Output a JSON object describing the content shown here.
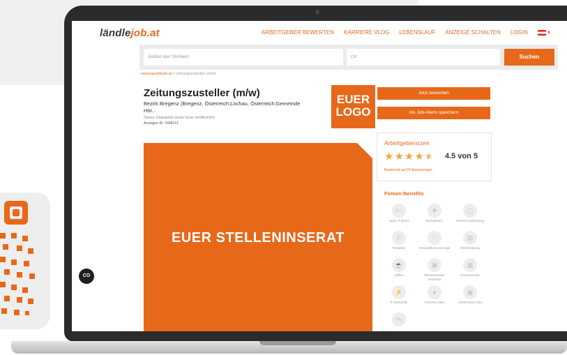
{
  "site": {
    "logo_part1": "ländle",
    "logo_part2": "job.at"
  },
  "nav": {
    "links": [
      "ARBEITGEBER BEWERTEN",
      "KARRIERE VLOG",
      "LEBENSLAUF",
      "ANZEIGE SCHALTEN",
      "LOGIN"
    ],
    "language_marker": "▾"
  },
  "search": {
    "keyword_placeholder": "Jobtitel oder Stichwort",
    "location_placeholder": "Ort",
    "button_label": "Suchen"
  },
  "breadcrumb": {
    "home": "www.laendlejob.at",
    "separator": ">",
    "current": "Zeitungszusteller (m/w)"
  },
  "job": {
    "title": "Zeitungszusteller (m/w)",
    "location": "Bezirk Bregenz (Bregenz, Österreich;Lochau, Österreich;Gemeinde Hör...",
    "published": "Dieses Jobangebot wurde heute veröffentlicht",
    "ad_id": "Anzeigen-ID: 2498212"
  },
  "company_logo_text": {
    "line1": "EUER",
    "line2": "LOGO"
  },
  "actions": {
    "apply": "Jetzt bewerben",
    "job_alarm": "Als Job-Alarm speichern"
  },
  "ad_banner": {
    "text": "EUER STELLENINSERAT"
  },
  "employer_score": {
    "title": "Arbeitgeberscore",
    "rating": 4.5,
    "rating_text": "4.5 von 5",
    "basis": "Basierend auf 24 Bewertungen"
  },
  "benefits": {
    "title": "Firmen Benefits",
    "items": [
      {
        "label": "Sport / Fitness",
        "icon": "dumbbell-icon",
        "glyph": "⊢"
      },
      {
        "label": "Betriebsarzt",
        "icon": "medical-bag-icon",
        "glyph": "✚"
      },
      {
        "label": "Verkehrs-anbindung",
        "icon": "bus-icon",
        "glyph": "▢"
      },
      {
        "label": "Parkplatz",
        "icon": "parking-icon",
        "glyph": "P"
      },
      {
        "label": "Gesundheits-vorsorge",
        "icon": "heart-icon",
        "glyph": "♡"
      },
      {
        "label": "Weiterbildung",
        "icon": "book-icon",
        "glyph": "▤"
      },
      {
        "label": "Kaffee",
        "icon": "coffee-icon",
        "glyph": "☕"
      },
      {
        "label": "Verkehrsmittel-zuschuss",
        "icon": "train-icon",
        "glyph": "▣"
      },
      {
        "label": "Firmenevents",
        "icon": "calendar-icon",
        "glyph": "▦"
      },
      {
        "label": "E-Tankstelle",
        "icon": "ev-charger-icon",
        "glyph": "⚡"
      },
      {
        "label": "Frisches Obst",
        "icon": "apple-icon",
        "glyph": "●"
      },
      {
        "label": "Unbefristete Jobs",
        "icon": "lock-icon",
        "glyph": "▣"
      },
      {
        "label": "",
        "icon": "percent-icon",
        "glyph": "%"
      }
    ]
  },
  "cookie_button": {
    "label": "CO"
  },
  "colors": {
    "accent": "#e8681a",
    "star": "#f2a73b",
    "text": "#222222"
  }
}
